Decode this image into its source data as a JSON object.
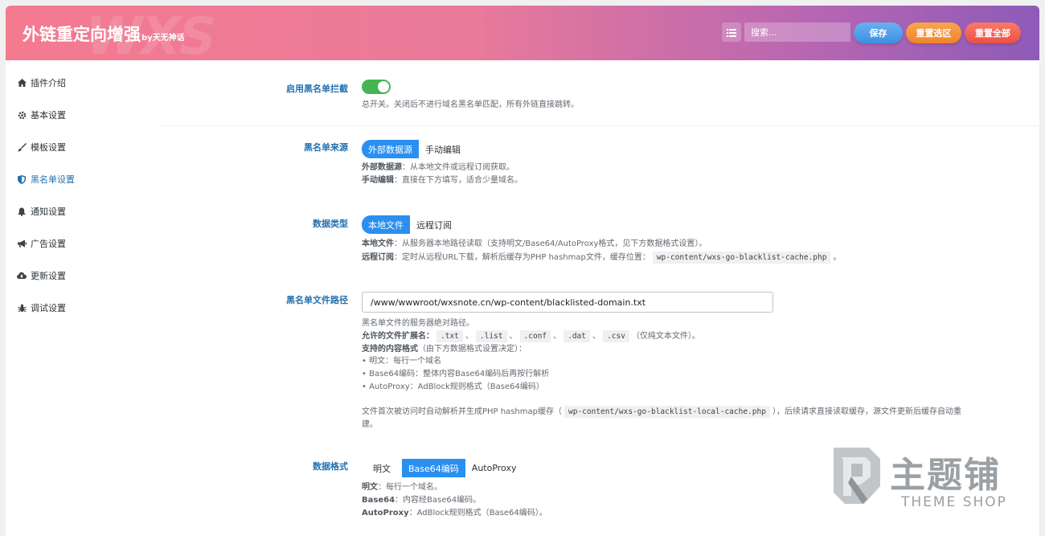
{
  "header": {
    "title": "外链重定向增强",
    "by": "by天无神话",
    "watermark": "WXS",
    "search_placeholder": "搜索...",
    "save_label": "保存",
    "reset_selection_label": "重置选区",
    "reset_all_label": "重置全部"
  },
  "sidebar": {
    "items": [
      {
        "label": "插件介绍",
        "icon": "home-icon"
      },
      {
        "label": "基本设置",
        "icon": "gear-icon"
      },
      {
        "label": "模板设置",
        "icon": "brush-icon"
      },
      {
        "label": "黑名单设置",
        "icon": "shield-icon"
      },
      {
        "label": "通知设置",
        "icon": "bell-icon"
      },
      {
        "label": "广告设置",
        "icon": "megaphone-icon"
      },
      {
        "label": "更新设置",
        "icon": "cloud-download-icon"
      },
      {
        "label": "调试设置",
        "icon": "bug-icon"
      }
    ],
    "active_index": 3
  },
  "fields": {
    "enable": {
      "label": "启用黑名单拦截",
      "enabled": true,
      "desc": "总开关。关闭后不进行域名黑名单匹配，所有外链直接跳转。"
    },
    "source": {
      "label": "黑名单来源",
      "options": [
        "外部数据源",
        "手动编辑"
      ],
      "selected": "外部数据源",
      "desc1_key": "外部数据源",
      "desc1_text": "：从本地文件或远程订阅获取。",
      "desc2_key": "手动编辑",
      "desc2_text": "：直接在下方填写，适合少量域名。"
    },
    "data_type": {
      "label": "数据类型",
      "options": [
        "本地文件",
        "远程订阅"
      ],
      "selected": "本地文件",
      "desc1_key": "本地文件",
      "desc1_text": "：从服务器本地路径读取（支持明文/Base64/AutoProxy格式，见下方数据格式设置）。",
      "desc2_key": "远程订阅",
      "desc2_text": "：定时从远程URL下载，解析后缓存为PHP hashmap文件，缓存位置：",
      "desc2_code": "wp-content/wxs-go-blacklist-cache.php",
      "desc2_end": "。"
    },
    "file_path": {
      "label": "黑名单文件路径",
      "value": "/www/wwwroot/wxsnote.cn/wp-content/blacklisted-domain.txt",
      "line1": "黑名单文件的服务器绝对路径。",
      "ext_key": "允许的文件扩展名：",
      "exts": [
        ".txt",
        ".list",
        ".conf",
        ".dat",
        ".csv"
      ],
      "ext_sep": "、",
      "ext_end": "（仅纯文本文件）。",
      "formats_key": "支持的内容格式",
      "formats_text": "（由下方数据格式设置决定）：",
      "bullet1": "• 明文：每行一个域名",
      "bullet2": "• Base64编码：整体内容Base64编码后再按行解析",
      "bullet3": "• AutoProxy：AdBlock规则格式（Base64编码）",
      "note_pre": "文件首次被访问时自动解析并生成PHP hashmap缓存（",
      "note_code": "wp-content/wxs-go-blacklist-local-cache.php",
      "note_post": "），后续请求直接读取缓存，源文件更新后缓存自动重",
      "note_wrap": "建。"
    },
    "data_format": {
      "label": "数据格式",
      "options": [
        "明文",
        "Base64编码",
        "AutoProxy"
      ],
      "selected": "Base64编码",
      "desc1_key": "明文",
      "desc1_text": "：每行一个域名。",
      "desc2_key": "Base64",
      "desc2_text": "：内容经Base64编码。",
      "desc3_key": "AutoProxy",
      "desc3_text": "：AdBlock规则格式（Base64编码）。"
    }
  },
  "logo": {
    "mark": "P",
    "text_cn": "主题铺",
    "text_en": "THEME SHOP"
  },
  "colors": {
    "accent": "#2b8ff0",
    "toggle_on": "#46b450",
    "label": "#2271b1"
  }
}
